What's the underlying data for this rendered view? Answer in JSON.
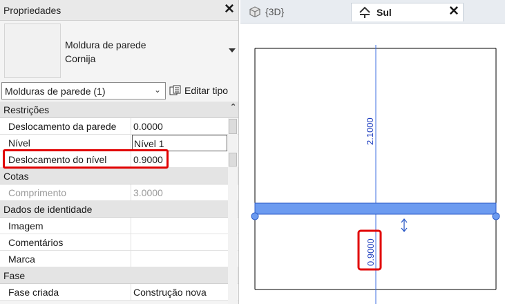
{
  "properties": {
    "title": "Propriedades",
    "type_family": "Moldura de parede",
    "type_name": "Cornija",
    "instance_filter": "Molduras de parede (1)",
    "edit_type_label": "Editar tipo",
    "categories": [
      {
        "label": "Restrições",
        "rows": [
          {
            "name": "Deslocamento da parede",
            "value": "0.0000"
          },
          {
            "name": "Nível",
            "value": "Nível 1"
          },
          {
            "name": "Deslocamento do nível",
            "value": "0.9000"
          }
        ]
      },
      {
        "label": "Cotas",
        "rows": [
          {
            "name": "Comprimento",
            "value": "3.0000"
          }
        ]
      },
      {
        "label": "Dados de identidade",
        "rows": [
          {
            "name": "Imagem",
            "value": ""
          },
          {
            "name": "Comentários",
            "value": ""
          },
          {
            "name": "Marca",
            "value": ""
          }
        ]
      },
      {
        "label": "Fase",
        "rows": [
          {
            "name": "Fase criada",
            "value": "Construção nova"
          }
        ]
      }
    ]
  },
  "view": {
    "tabs": [
      {
        "label": "{3D}",
        "icon": "3d-cube-icon",
        "active": false
      },
      {
        "label": "Sul",
        "icon": "elevation-house-icon",
        "active": true
      }
    ],
    "dimensions": {
      "upper": "2.1000",
      "lower": "0.9000"
    }
  },
  "colors": {
    "highlight": "#e10000",
    "dimension": "#1f3fbf",
    "molding_fill": "#6c9bf0"
  }
}
